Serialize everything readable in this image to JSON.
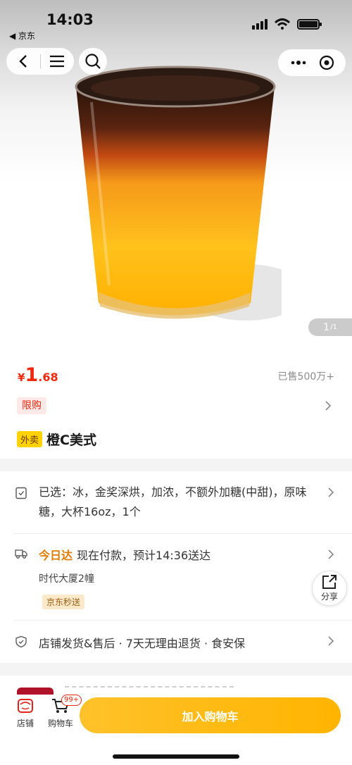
{
  "status": {
    "time": "14:03",
    "back_app": "◀ 京东"
  },
  "gallery": {
    "index": "1",
    "total": "/1"
  },
  "product": {
    "currency": "¥",
    "price_int": "1",
    "price_dec": ".68",
    "sold": "已售500万+",
    "limit_tag": "限购",
    "takeout_tag": "外卖",
    "name": "橙C美式"
  },
  "selection": {
    "text": "已选：冰，金奖深烘，加浓，不额外加糖(中甜)，原味糖，大杯16oz，1个"
  },
  "delivery": {
    "today": "今日达",
    "text": "现在付款，预计14:36送达",
    "address": "时代大厦2幢",
    "tag": "京东秒送"
  },
  "service": {
    "text": "店铺发货&售后 · 7天无理由退货 · 食安保"
  },
  "share": {
    "label": "分享"
  },
  "bottom": {
    "store_label": "店铺",
    "cart_label": "购物车",
    "cart_badge": "99+",
    "add_to_cart": "加入购物车"
  },
  "colors": {
    "price": "#f2270c",
    "accent": "#ffb400",
    "today": "#e17b00"
  }
}
